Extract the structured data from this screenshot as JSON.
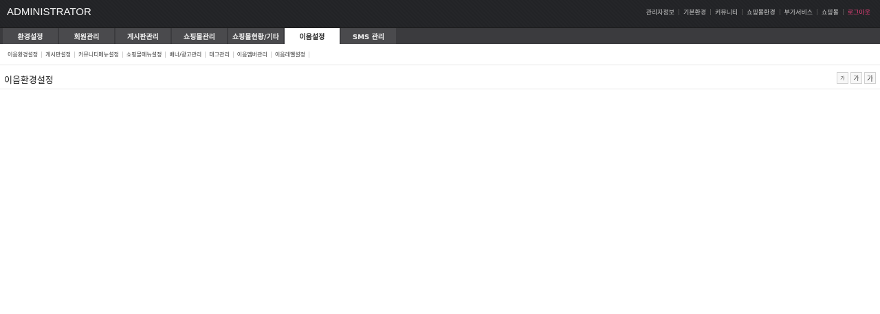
{
  "header": {
    "logo": "ADMINISTRATOR",
    "links": [
      "관리자정보",
      "기본환경",
      "커뮤니티",
      "쇼핑몰환경",
      "부가서비스",
      "쇼핑몰",
      "로그아웃"
    ]
  },
  "main_nav": {
    "tabs": [
      "환경설정",
      "회원관리",
      "게시판관리",
      "쇼핑몰관리",
      "쇼핑몰현황/기타",
      "이음설정",
      "SMS 관리"
    ],
    "active_index": 5
  },
  "sub_nav": {
    "items": [
      "이음환경설정",
      "게시판설정",
      "커뮤니티메뉴설정",
      "쇼핑몰메뉴설정",
      "배너/광고관리",
      "태그관리",
      "이음멤버관리",
      "이음레벨설정"
    ]
  },
  "page": {
    "title": "이음환경설정",
    "font_buttons": [
      "가",
      "가",
      "가"
    ]
  },
  "colors": {
    "topbar": "#222326",
    "nav": "#3b3b3e",
    "logout": "#e8407a"
  }
}
